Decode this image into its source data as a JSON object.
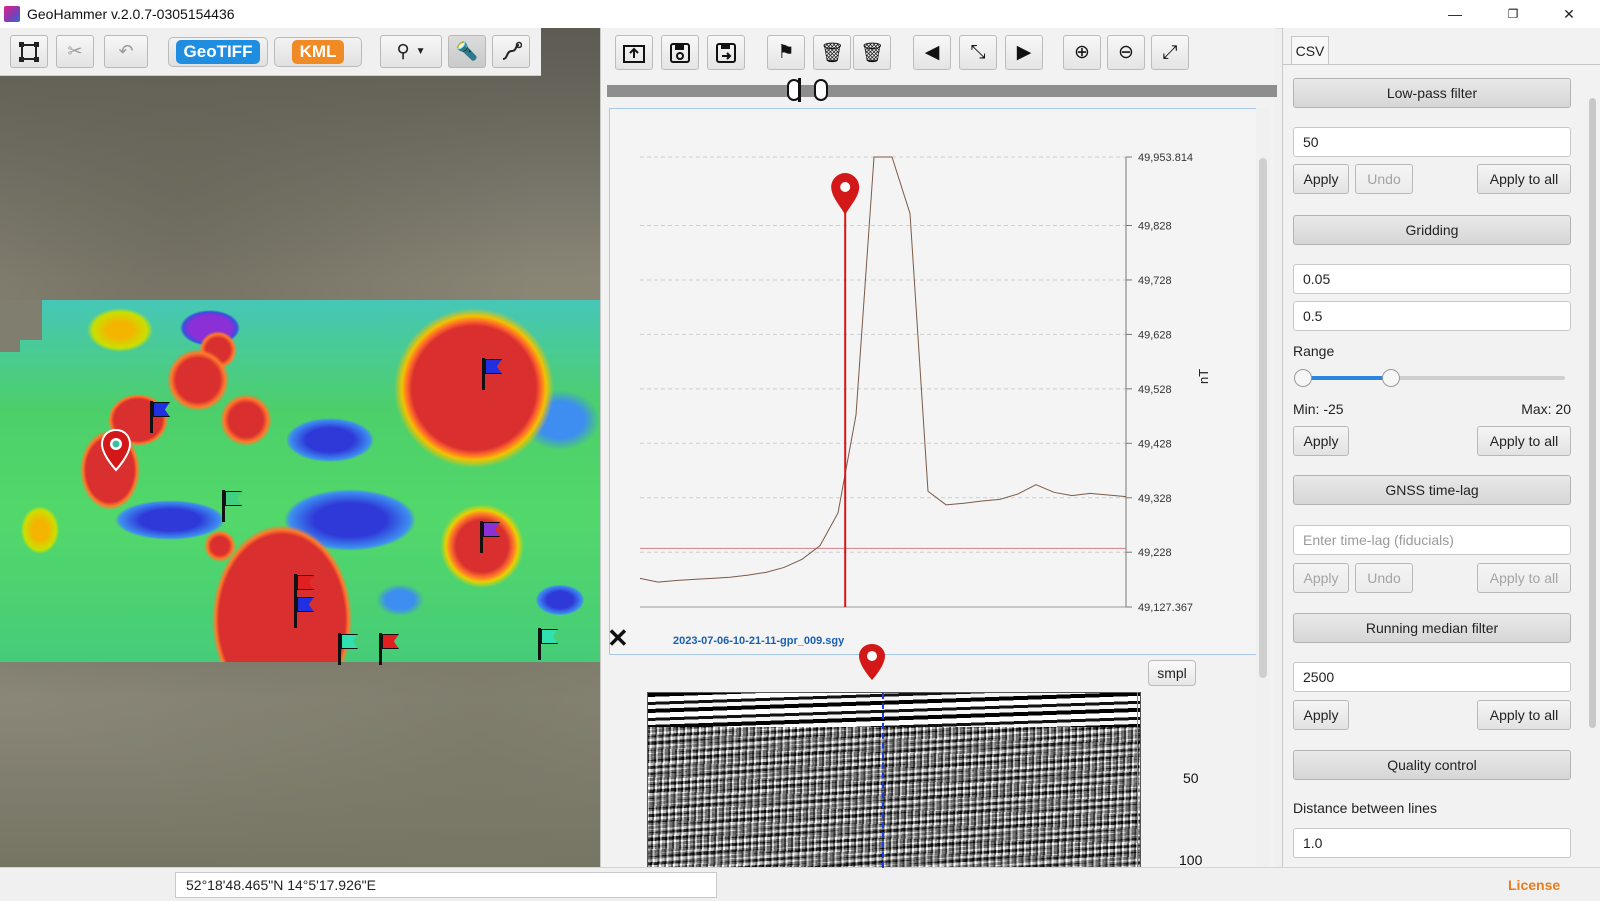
{
  "window": {
    "title": "GeoHammer v.2.0.7-0305154436",
    "minimize": "—",
    "restore": "❐",
    "close": "✕"
  },
  "left_toolbar": {
    "geotiff_label": "GeoTIFF",
    "kml_label": "KML"
  },
  "mid_toolbar": {
    "file_name": "2023-07-06-10-21-11-gpr_009.sgy",
    "smpl_label": "smpl"
  },
  "chart_data": {
    "type": "line",
    "ylabel": "nT",
    "ylim": [
      49127.367,
      49953.814
    ],
    "yticks": [
      "49,953.814",
      "49,828",
      "49,728",
      "49,628",
      "49,528",
      "49,428",
      "49,328",
      "49,228",
      "49,127.367"
    ],
    "ytick_values": [
      49953.814,
      49828,
      49728,
      49628,
      49528,
      49428,
      49328,
      49228,
      49127.367
    ],
    "series_y": [
      49180,
      49173,
      49176,
      49178,
      49180,
      49182,
      49186,
      49191,
      49200,
      49215,
      49240,
      49300,
      49480,
      49960,
      49960,
      49850,
      49340,
      49315,
      49318,
      49322,
      49325,
      49335,
      49352,
      49338,
      49332,
      49336,
      49333,
      49330
    ],
    "marker_index": 11.4,
    "threshold": 49235,
    "colors": {
      "line": "#7a5a48",
      "marker": "#d21818",
      "threshold": "#d9808a"
    }
  },
  "gpr": {
    "ticks": [
      "50",
      "100"
    ]
  },
  "right_panel": {
    "tab": "CSV",
    "lowpass": {
      "title": "Low-pass filter",
      "value": "50",
      "apply": "Apply",
      "undo": "Undo",
      "apply_all": "Apply to all"
    },
    "gridding": {
      "title": "Gridding",
      "cell": "0.05",
      "blank": "0.5",
      "range_label": "Range",
      "min": "Min: -25",
      "max": "Max: 20",
      "apply": "Apply",
      "apply_all": "Apply to all"
    },
    "gnss": {
      "title": "GNSS time-lag",
      "placeholder": "Enter time-lag (fiducials)",
      "apply": "Apply",
      "undo": "Undo",
      "apply_all": "Apply to all"
    },
    "median": {
      "title": "Running median filter",
      "value": "2500",
      "apply": "Apply",
      "apply_all": "Apply to all"
    },
    "quality": {
      "title": "Quality control",
      "distance_label": "Distance between lines",
      "distance": "1.0"
    }
  },
  "status": {
    "coordinates": "52°18'48.465\"N  14°5'17.926\"E",
    "license": "License"
  },
  "colors": {
    "accent": "#2a86e0",
    "geotiff": "#1f8de0",
    "kml": "#f08a24",
    "license": "#e87d1a"
  }
}
